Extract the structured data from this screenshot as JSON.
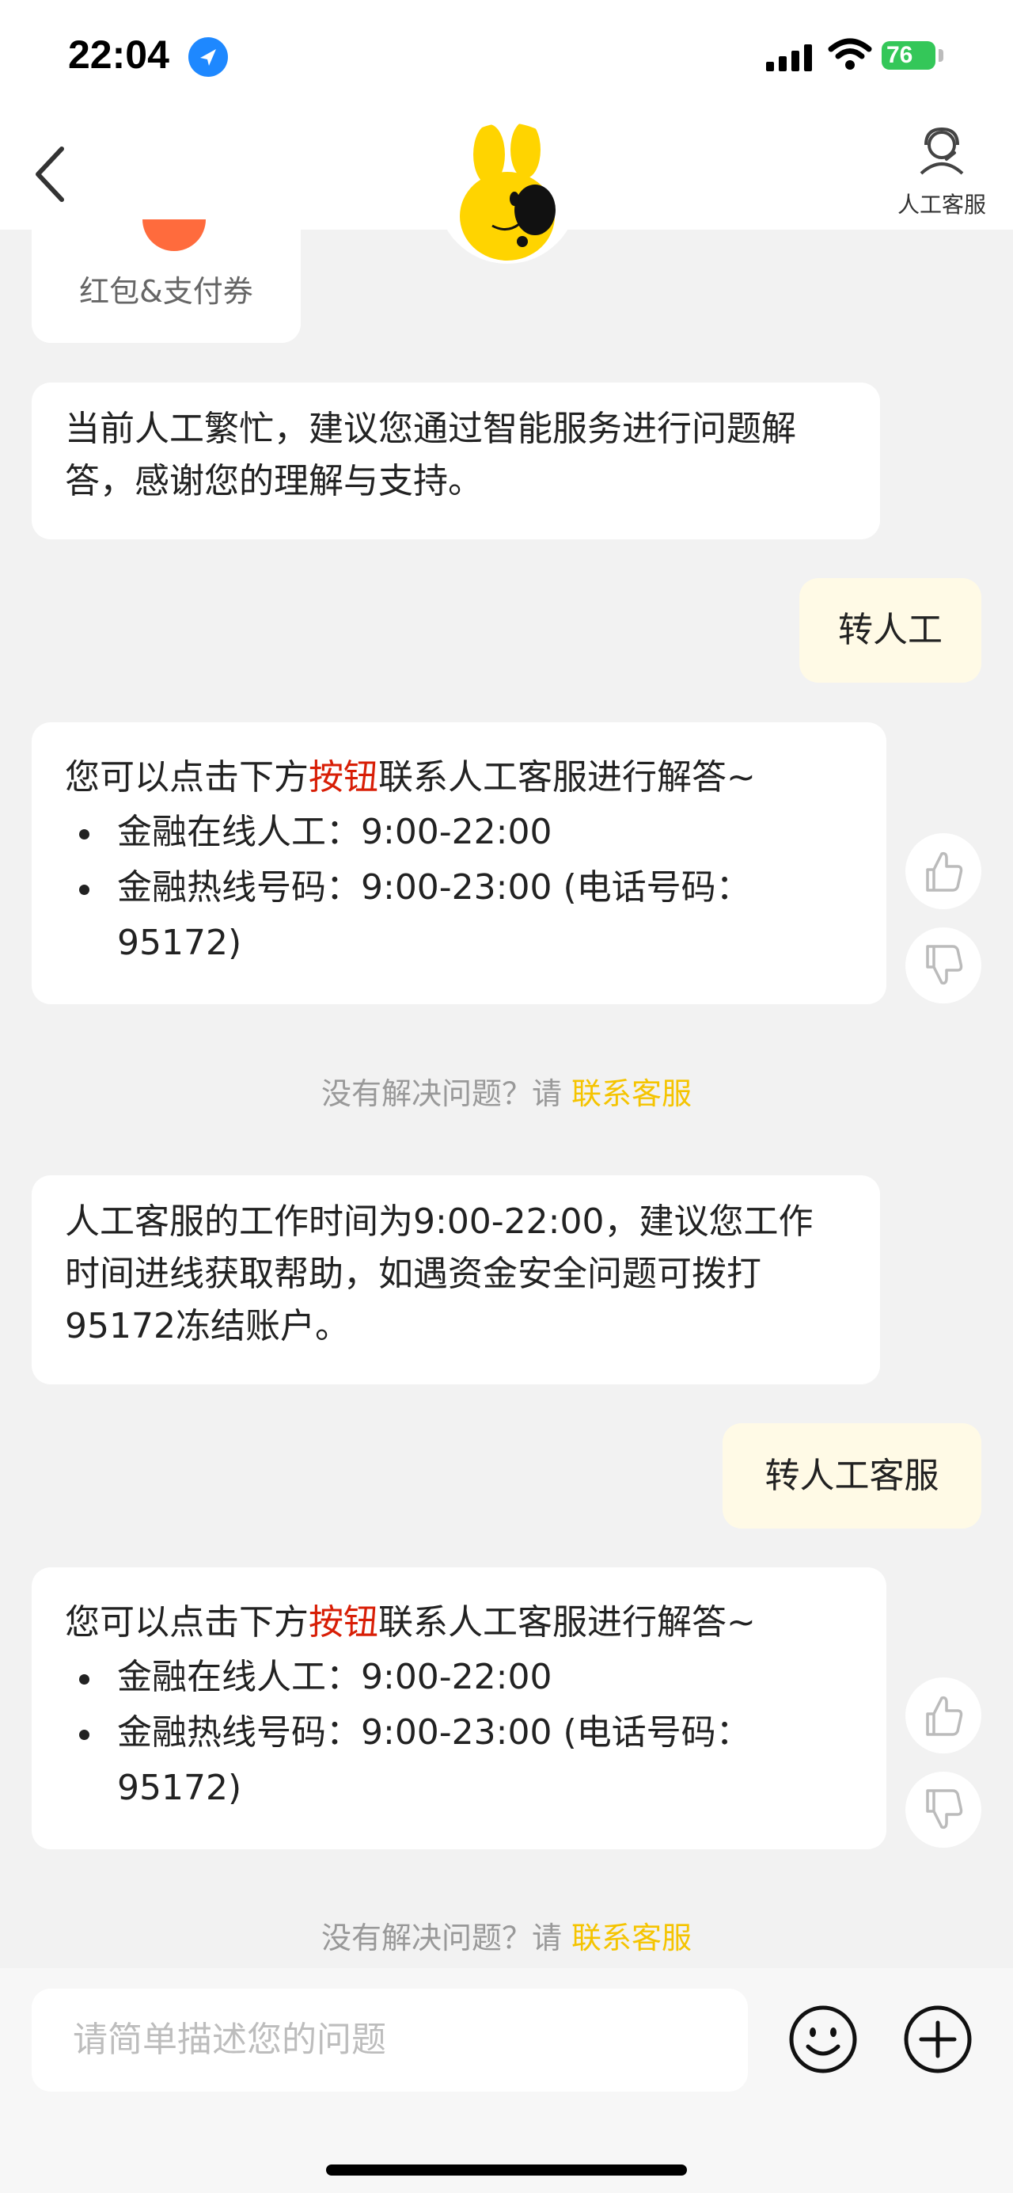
{
  "status_bar": {
    "time": "22:04",
    "battery": "76",
    "icons": [
      "location-icon",
      "signal-icon",
      "wifi-icon",
      "battery-icon"
    ]
  },
  "nav": {
    "back_icon": "chevron-left-icon",
    "mascot_icon": "rabbit-mascot-icon",
    "agent_label": "人工客服",
    "agent_icon": "headset-icon"
  },
  "messages": {
    "coupon_label": "红包&支付券",
    "bot_busy": "当前人工繁忙，建议您通过智能服务进行问题解答，感谢您的理解与支持。",
    "user_1": "转人工",
    "contact_block_1": {
      "intro_before": "您可以点击下方",
      "intro_highlight": "按钮",
      "intro_after": "联系人工客服进行解答~",
      "items": [
        "金融在线人工：9:00-22:00",
        "金融热线号码：9:00-23:00 (电话号码：95172)"
      ]
    },
    "hint_1": {
      "prefix": "没有解决问题？请 ",
      "link": "联系客服"
    },
    "bot_hours": "人工客服的工作时间为9:00-22:00，建议您工作时间进线获取帮助，如遇资金安全问题可拨打95172冻结账户。",
    "user_2": "转人工客服",
    "contact_block_2": {
      "intro_before": "您可以点击下方",
      "intro_highlight": "按钮",
      "intro_after": "联系人工客服进行解答~",
      "items": [
        "金融在线人工：9:00-22:00",
        "金融热线号码：9:00-23:00 (电话号码：95172)"
      ]
    },
    "hint_2": {
      "prefix": "没有解决问题？请 ",
      "link": "联系客服"
    }
  },
  "input": {
    "placeholder": "请简单描述您的问题",
    "emoji_icon": "emoji-icon",
    "plus_icon": "plus-icon"
  },
  "colors": {
    "accent_yellow": "#f5c400",
    "highlight_red": "#d81e06",
    "user_bubble": "#fffae6",
    "background": "#f2f2f2"
  }
}
